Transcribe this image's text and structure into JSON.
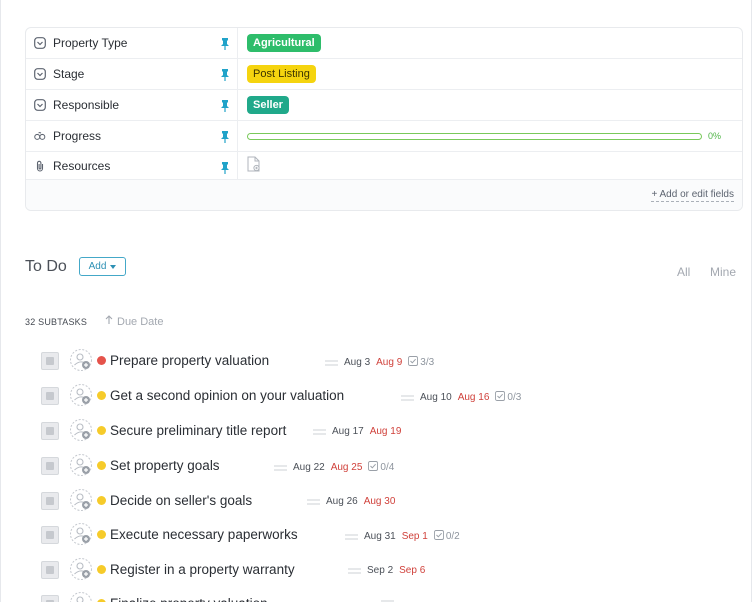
{
  "fields": [
    {
      "name": "Property Type",
      "icon": "dropdown-field-icon",
      "type": "tag",
      "value": "Agricultural",
      "color": "#2ebd6b"
    },
    {
      "name": "Stage",
      "icon": "dropdown-field-icon",
      "type": "tag",
      "value": "Post Listing",
      "color": "#f5d40f"
    },
    {
      "name": "Responsible",
      "icon": "dropdown-field-icon",
      "type": "tag",
      "value": "Seller",
      "color": "#20a98a"
    },
    {
      "name": "Progress",
      "icon": "progress-field-icon",
      "type": "progress",
      "value": "0%",
      "progress": 0
    },
    {
      "name": "Resources",
      "icon": "paperclip-icon",
      "type": "file",
      "value": ""
    }
  ],
  "add_fields_label": "+ Add or edit fields",
  "todo": {
    "title": "To Do",
    "add_label": "Add",
    "filters": [
      "All",
      "Mine"
    ],
    "subtask_count": "32 SUBTASKS",
    "sort_label": "Due Date"
  },
  "tasks": [
    {
      "name": "Prepare property valuation",
      "status": "red",
      "start": "Aug 3",
      "due": "Aug 9",
      "checklist": "3/3"
    },
    {
      "name": "Get a second opinion on your valuation",
      "status": "yellow",
      "start": "Aug 10",
      "due": "Aug 16",
      "checklist": "0/3"
    },
    {
      "name": "Secure preliminary title report",
      "status": "yellow",
      "start": "Aug 17",
      "due": "Aug 19",
      "checklist": ""
    },
    {
      "name": "Set property goals",
      "status": "yellow",
      "start": "Aug 22",
      "due": "Aug 25",
      "checklist": "0/4"
    },
    {
      "name": "Decide on seller's goals",
      "status": "yellow",
      "start": "Aug 26",
      "due": "Aug 30",
      "checklist": ""
    },
    {
      "name": "Execute necessary paperworks",
      "status": "yellow",
      "start": "Aug 31",
      "due": "Sep 1",
      "checklist": "0/2"
    },
    {
      "name": "Register in a property warranty",
      "status": "yellow",
      "start": "Sep 2",
      "due": "Sep 6",
      "checklist": ""
    },
    {
      "name": "Finalize property valuation",
      "status": "yellow",
      "start": "",
      "due": "",
      "checklist": ""
    }
  ],
  "colors": {
    "accent": "#2c90b4",
    "pin": "#21a3c9",
    "due": "#d0413b",
    "progress": "#79c95a"
  }
}
